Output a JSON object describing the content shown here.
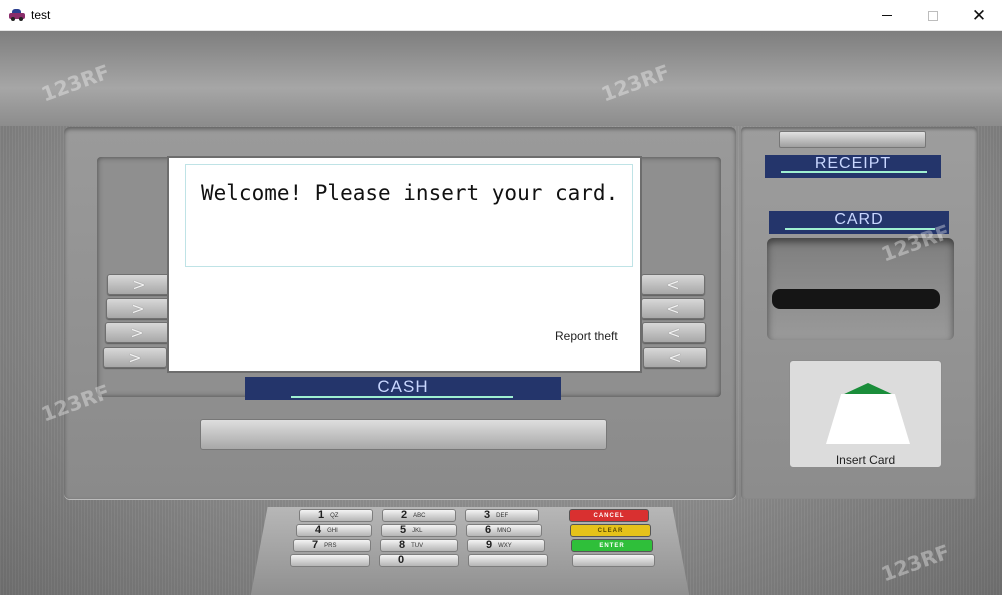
{
  "window": {
    "title": "test",
    "minimize_icon": "minimize-icon",
    "maximize_icon": "maximize-icon",
    "close_glyph": "✕"
  },
  "screen": {
    "message": "Welcome! Please insert your card.",
    "report_link": "Report theft"
  },
  "side_buttons": {
    "left_glyph": ">",
    "right_glyph": "<"
  },
  "labels": {
    "cash": "CASH",
    "receipt": "RECEIPT",
    "card": "CARD"
  },
  "insert_card": {
    "label": "Insert Card"
  },
  "keypad": {
    "keys": [
      {
        "digit": "1",
        "letters": "QZ"
      },
      {
        "digit": "2",
        "letters": "ABC"
      },
      {
        "digit": "3",
        "letters": "DEF"
      },
      {
        "digit": "4",
        "letters": "GHI"
      },
      {
        "digit": "5",
        "letters": "JKL"
      },
      {
        "digit": "6",
        "letters": "MNO"
      },
      {
        "digit": "7",
        "letters": "PRS"
      },
      {
        "digit": "8",
        "letters": "TUV"
      },
      {
        "digit": "9",
        "letters": "WXY"
      },
      {
        "digit": "0",
        "letters": ""
      }
    ],
    "cancel": "CANCEL",
    "clear": "CLEAR",
    "enter": "ENTER"
  },
  "watermark": "123RF",
  "colors": {
    "label_plate": "#24356b",
    "stripe": "#9ff0d2",
    "cancel": "#d93030",
    "clear": "#e6c21a",
    "enter": "#2fbf3a",
    "insert_arrow": "#1a8d3a"
  }
}
